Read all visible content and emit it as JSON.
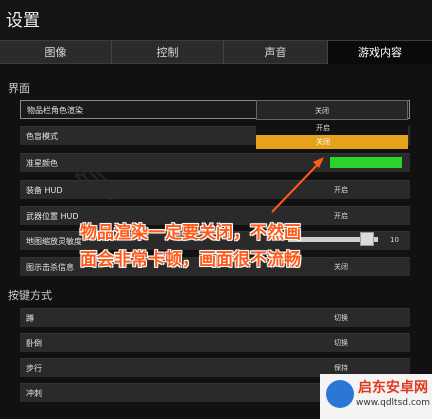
{
  "header": {
    "title": "设置"
  },
  "tabs": [
    {
      "label": "图像",
      "active": false
    },
    {
      "label": "控制",
      "active": false
    },
    {
      "label": "声音",
      "active": false
    },
    {
      "label": "游戏内容",
      "active": true
    }
  ],
  "sections": {
    "interface": "界面",
    "keybind": "按键方式"
  },
  "interface_rows": [
    {
      "label": "物品栏角色渲染",
      "value": "关闭"
    },
    {
      "label": "色盲模式",
      "value": ""
    },
    {
      "label": "准星颜色",
      "value": "绿色"
    },
    {
      "label": "装备 HUD",
      "value": "开启"
    },
    {
      "label": "武器位置 HUD",
      "value": "开启"
    },
    {
      "label": "地图缩放灵敏度",
      "value": "10"
    },
    {
      "label": "图示击杀信息",
      "value": "关闭"
    }
  ],
  "dropdown": {
    "current": "关闭",
    "options": [
      "开启",
      "关闭"
    ],
    "selected_index": 1
  },
  "crosshair_color": "#2bd32b",
  "map_zoom_sensitivity": 10,
  "keybind_rows": [
    {
      "label": "蹲",
      "value": "切换"
    },
    {
      "label": "卧倒",
      "value": "切换"
    },
    {
      "label": "步行",
      "value": "保持"
    },
    {
      "label": "冲刺",
      "value": ""
    }
  ],
  "annotation": {
    "line1": "物品渲染一定要关闭，不然画",
    "line2": "面会非常卡顿，画面很不流畅",
    "color": "#ff5a1a"
  },
  "watermark": {
    "name": "启东安卓网",
    "url": "www.qdltsd.com"
  }
}
